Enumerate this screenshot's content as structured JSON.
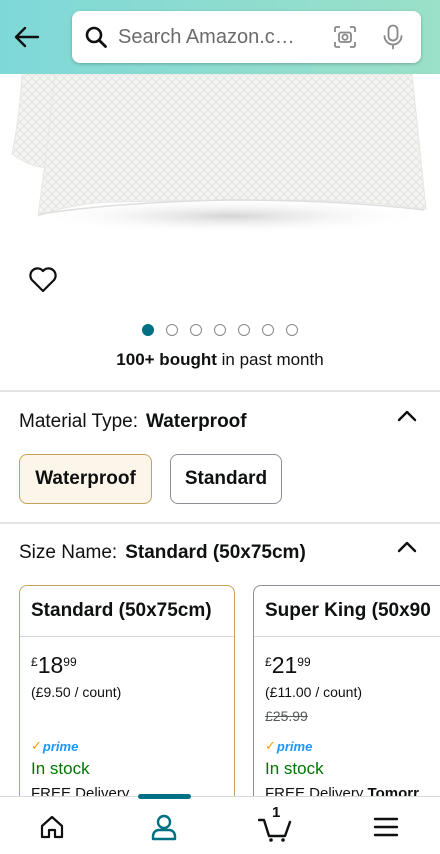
{
  "header": {
    "search_placeholder": "Search Amazon.c…"
  },
  "product": {
    "dots_count": 7,
    "active_dot": 0,
    "bought_bold": "100+ bought",
    "bought_rest": " in past month"
  },
  "material": {
    "label": "Material Type:",
    "value": "Waterproof",
    "options": [
      "Waterproof",
      "Standard"
    ],
    "selected": "Waterproof"
  },
  "size": {
    "label": "Size Name:",
    "value": "Standard (50x75cm)",
    "cards": [
      {
        "title": "Standard (50x75cm)",
        "currency": "£",
        "price_whole": "18",
        "price_fraction": "99",
        "unit_price": "(£9.50 / count)",
        "list_price": "",
        "prime": "prime",
        "stock": "In stock",
        "delivery": "FREE Delivery"
      },
      {
        "title": "Super King (50x90",
        "currency": "£",
        "price_whole": "21",
        "price_fraction": "99",
        "unit_price": "(£11.00 / count)",
        "list_price": "£25.99",
        "prime": "prime",
        "stock": "In stock",
        "delivery": "FREE Delivery",
        "delivery_bold": "Tomorr"
      }
    ]
  },
  "nav": {
    "cart_count": "1",
    "active": "account"
  }
}
